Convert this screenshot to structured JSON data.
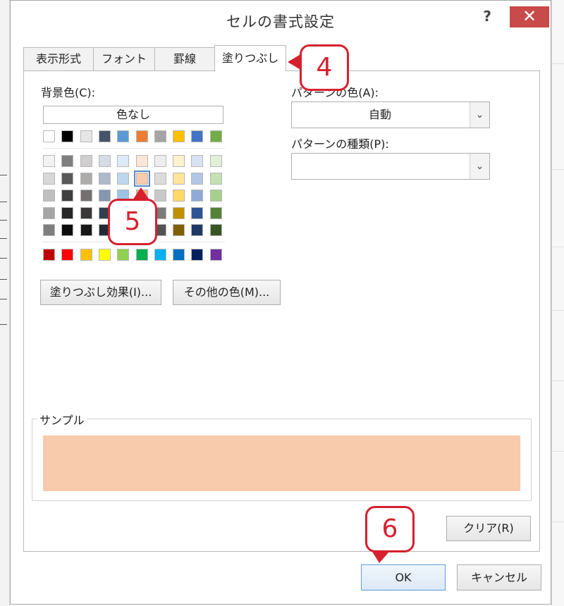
{
  "dialog": {
    "title": "セルの書式設定",
    "help": "?",
    "close": "✕"
  },
  "tabs": [
    {
      "label": "表示形式",
      "active": false
    },
    {
      "label": "フォント",
      "active": false
    },
    {
      "label": "罫線",
      "active": false
    },
    {
      "label": "塗りつぶし",
      "active": true
    }
  ],
  "fill": {
    "background_color_label": "背景色(C):",
    "no_color_label": "色なし",
    "selected_color": "#f8cbad",
    "theme_top_row": [
      "#ffffff",
      "#000000",
      "#e7e6e6",
      "#44546a",
      "#5b9bd5",
      "#ed7d31",
      "#a5a5a5",
      "#ffc000",
      "#4472c4",
      "#70ad47"
    ],
    "theme_shades": [
      [
        "#f2f2f2",
        "#7f7f7f",
        "#d0cece",
        "#d6dce4",
        "#deebf6",
        "#fbe5d5",
        "#ededed",
        "#fff2cc",
        "#d9e2f3",
        "#e2efd9"
      ],
      [
        "#d8d8d8",
        "#595959",
        "#aeabab",
        "#adb9ca",
        "#bdd7ee",
        "#f8cbad",
        "#dbdbdb",
        "#ffe598",
        "#b4c6e7",
        "#c5e0b3"
      ],
      [
        "#bfbfbf",
        "#3f3f3f",
        "#757070",
        "#8496b0",
        "#9dc3e6",
        "#f4b183",
        "#c9c9c9",
        "#ffd965",
        "#8eaadb",
        "#a8d08d"
      ],
      [
        "#a5a5a5",
        "#262626",
        "#3a3838",
        "#323f4f",
        "#2e75b5",
        "#c55a11",
        "#7b7b7b",
        "#bf9000",
        "#2f5496",
        "#538135"
      ],
      [
        "#7f7f7f",
        "#0c0c0c",
        "#171616",
        "#222a35",
        "#1f4e79",
        "#843c0b",
        "#525252",
        "#7f6000",
        "#1f3864",
        "#375623"
      ]
    ],
    "standard_colors": [
      "#c00000",
      "#ff0000",
      "#ffc000",
      "#ffff00",
      "#92d050",
      "#00b050",
      "#00b0f0",
      "#0070c0",
      "#002060",
      "#7030a0"
    ],
    "fill_effects_button": "塗りつぶし効果(I)...",
    "more_colors_button": "その他の色(M)...",
    "pattern_color_label": "パターンの色(A):",
    "pattern_color_value": "自動",
    "pattern_style_label": "パターンの種類(P):",
    "pattern_style_value": "",
    "sample_label": "サンプル"
  },
  "footer": {
    "clear_button": "クリア(R)",
    "ok_button": "OK",
    "cancel_button": "キャンセル"
  },
  "annotations": [
    "4",
    "5",
    "6"
  ],
  "colors": {
    "callout": "#d6202e",
    "close_button": "#c84a4a"
  }
}
